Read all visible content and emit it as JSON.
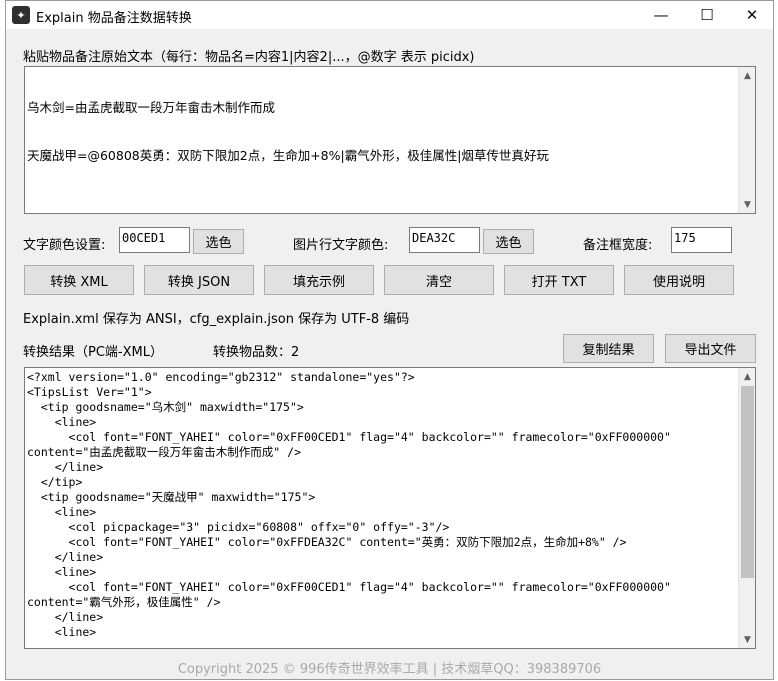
{
  "window": {
    "title": "Explain 物品备注数据转换",
    "controls": {
      "minimize": "—",
      "maximize": "☐",
      "close": "✕"
    }
  },
  "input_section": {
    "label": "粘贴物品备注原始文本（每行：物品名=内容1|内容2|...，@数字 表示 picidx)",
    "lines": [
      "乌木剑=由孟虎截取一段万年畲击木制作而成",
      "天魔战甲=@60808英勇：双防下限加2点，生命加+8%|霸气外形，极佳属性|烟草传世真好玩"
    ]
  },
  "settings": {
    "text_color_label": "文字颜色设置:",
    "text_color_value": "00CED1",
    "text_color_pick": "选色",
    "image_text_color_label": "图片行文字颜色:",
    "image_text_color_value": "DEA32C",
    "image_text_color_pick": "选色",
    "width_label": "备注框宽度:",
    "width_value": "175"
  },
  "actions": {
    "convert_xml": "转换 XML",
    "convert_json": "转换 JSON",
    "fill_example": "填充示例",
    "clear": "清空",
    "open_txt": "打开 TXT",
    "help": "使用说明"
  },
  "save_note": "Explain.xml 保存为 ANSI，cfg_explain.json 保存为 UTF-8 编码",
  "result": {
    "label": "转换结果（PC端-XML）",
    "count_text": "转换物品数：2",
    "copy_button": "复制结果",
    "export_button": "导出文件",
    "lines": [
      "<?xml version=\"1.0\" encoding=\"gb2312\" standalone=\"yes\"?>",
      "<TipsList Ver=\"1\">",
      "  <tip goodsname=\"乌木剑\" maxwidth=\"175\">",
      "    <line>",
      "      <col font=\"FONT_YAHEI\" color=\"0xFF00CED1\" flag=\"4\" backcolor=\"\" framecolor=\"0xFF000000\"",
      "content=\"由孟虎截取一段万年畲击木制作而成\" />",
      "    </line>",
      "  </tip>",
      "  <tip goodsname=\"天魔战甲\" maxwidth=\"175\">",
      "    <line>",
      "      <col picpackage=\"3\" picidx=\"60808\" offx=\"0\" offy=\"-3\"/>",
      "      <col font=\"FONT_YAHEI\" color=\"0xFFDEA32C\" content=\"英勇：双防下限加2点，生命加+8%\" />",
      "    </line>",
      "    <line>",
      "      <col font=\"FONT_YAHEI\" color=\"0xFF00CED1\" flag=\"4\" backcolor=\"\" framecolor=\"0xFF000000\"",
      "content=\"霸气外形，极佳属性\" />",
      "    </line>",
      "    <line>"
    ]
  },
  "footer": {
    "copyright": "Copyright 2025 © 996传奇世界效率工具 | 技术烟草QQ：398389706"
  },
  "colors": {
    "window_bg": "#f0f0f0",
    "button_bg": "#e1e1e1",
    "copyright_gray": "#a9a9a9"
  }
}
